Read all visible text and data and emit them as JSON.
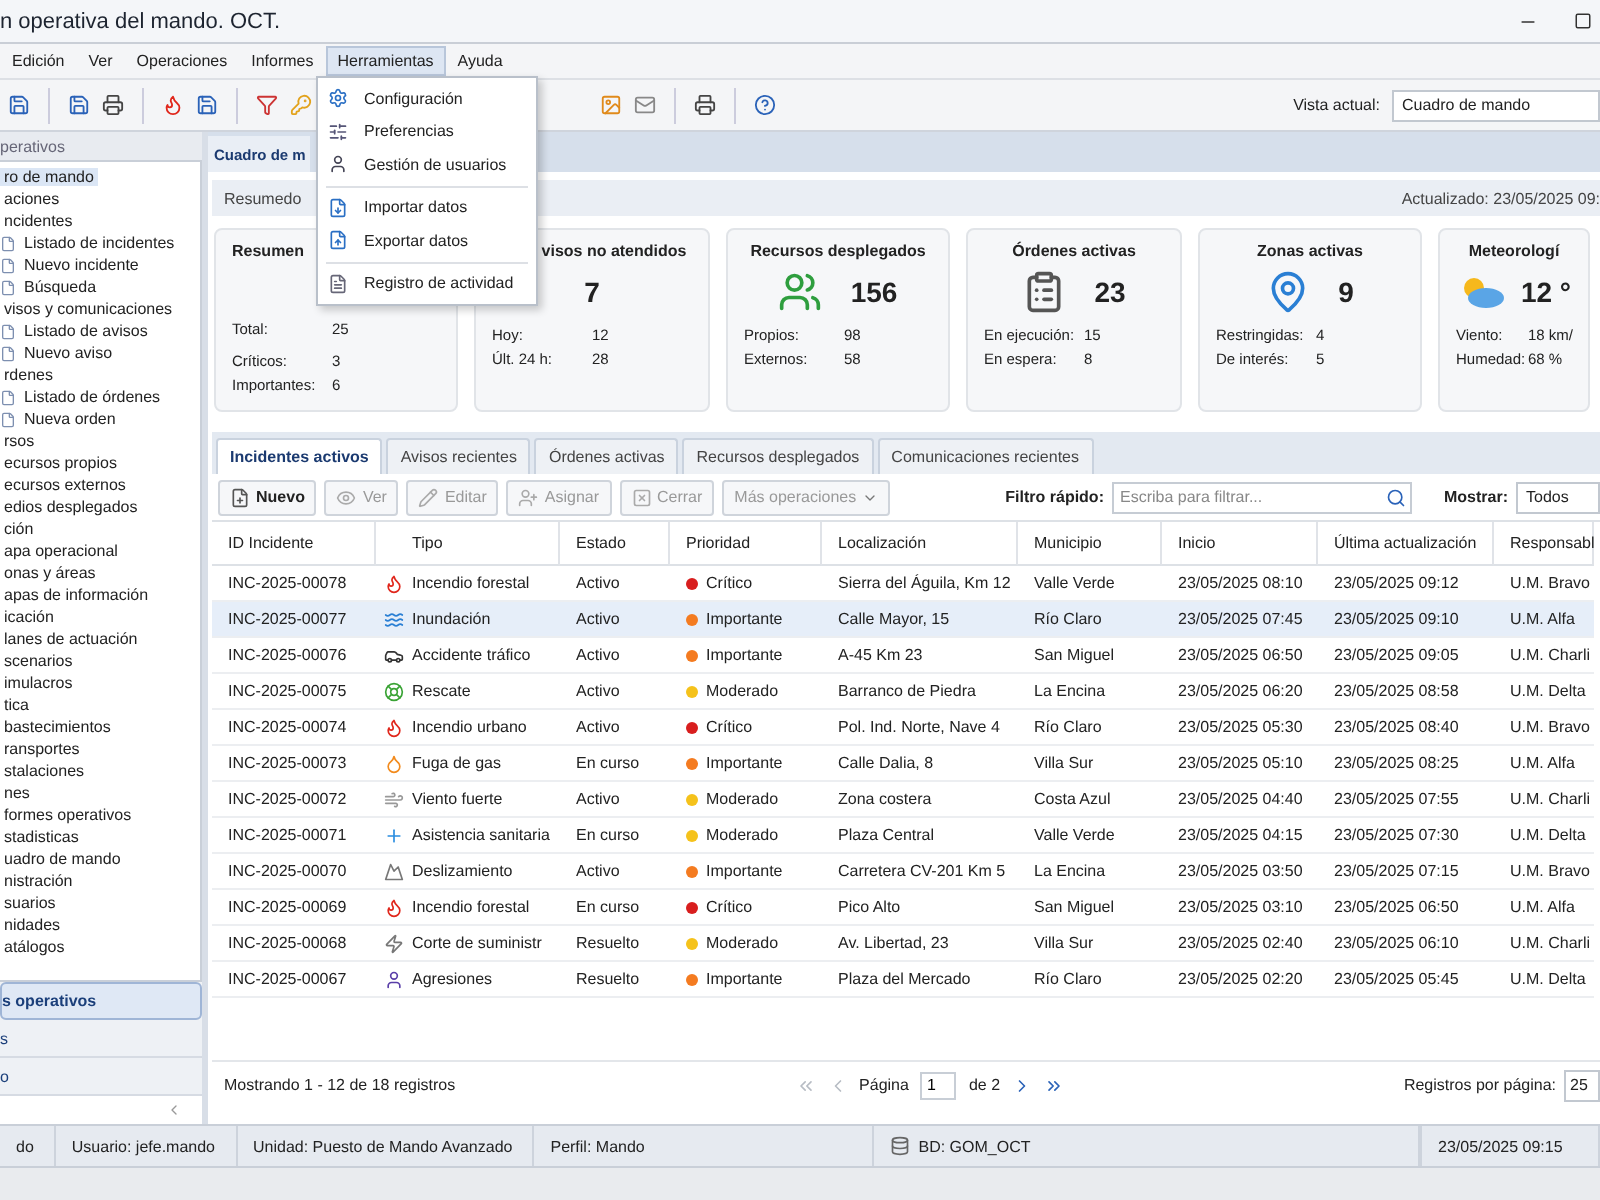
{
  "window": {
    "title": "n operativa del mando. OCT."
  },
  "menu": [
    {
      "label": "Edición",
      "selected": false
    },
    {
      "label": "Ver",
      "selected": false
    },
    {
      "label": "Operaciones",
      "selected": false
    },
    {
      "label": "Informes",
      "selected": false
    },
    {
      "label": "Herramientas",
      "selected": true
    },
    {
      "label": "Ayuda",
      "selected": false
    }
  ],
  "dropdown": [
    [
      "Configuración",
      "Preferencias",
      "Gestión de usuarios"
    ],
    [
      "Importar datos",
      "Exportar datos"
    ],
    [
      "Registro de actividad"
    ]
  ],
  "view": {
    "label": "Vista actual:",
    "value": "Cuadro de mando"
  },
  "sidebar": {
    "title": "perativos",
    "tree": [
      {
        "label": "ro de mando",
        "selected": true
      },
      {
        "label": "aciones",
        "selected": false,
        "children": [
          {
            "label": "ncidentes",
            "selected": false,
            "children": [
              {
                "label": "Listado de incidentes",
                "selected": false
              },
              {
                "label": "Nuevo incidente",
                "selected": false
              },
              {
                "label": "Búsqueda",
                "selected": false
              }
            ]
          },
          {
            "label": "visos y comunicaciones",
            "selected": false,
            "children": [
              {
                "label": "Listado de avisos",
                "selected": false
              },
              {
                "label": "Nuevo aviso",
                "selected": false
              }
            ]
          },
          {
            "label": "rdenes",
            "selected": false,
            "children": [
              {
                "label": "Listado de órdenes",
                "selected": false
              },
              {
                "label": "Nueva orden",
                "selected": false
              }
            ]
          }
        ]
      },
      {
        "label": "rsos",
        "selected": false,
        "children": [
          {
            "label": "ecursos propios",
            "selected": false
          },
          {
            "label": "ecursos externos",
            "selected": false
          },
          {
            "label": "edios desplegados",
            "selected": false
          }
        ]
      },
      {
        "label": "ción",
        "selected": false,
        "children": [
          {
            "label": "apa operacional",
            "selected": false
          },
          {
            "label": "onas y áreas",
            "selected": false
          },
          {
            "label": "apas de información",
            "selected": false
          }
        ]
      },
      {
        "label": "icación",
        "selected": false,
        "children": [
          {
            "label": "lanes de actuación",
            "selected": false
          },
          {
            "label": "scenarios",
            "selected": false
          },
          {
            "label": "imulacros",
            "selected": false
          }
        ]
      },
      {
        "label": "tica",
        "selected": false,
        "children": [
          {
            "label": "bastecimientos",
            "selected": false
          },
          {
            "label": "ransportes",
            "selected": false
          },
          {
            "label": "stalaciones",
            "selected": false
          }
        ]
      },
      {
        "label": "nes",
        "selected": false,
        "children": [
          {
            "label": "formes operativos",
            "selected": false
          },
          {
            "label": "stadisticas",
            "selected": false
          },
          {
            "label": "uadro de mando",
            "selected": false
          }
        ]
      },
      {
        "label": "nistración",
        "selected": false,
        "children": [
          {
            "label": "suarios",
            "selected": false
          },
          {
            "label": "nidades",
            "selected": false
          },
          {
            "label": "atálogos",
            "selected": false
          }
        ]
      }
    ],
    "sections": [
      {
        "label": "s operativos",
        "selected": true
      },
      {
        "label": "s",
        "selected": false
      },
      {
        "label": "o",
        "selected": false
      }
    ]
  },
  "main_tab": "Cuadro de m",
  "summary": {
    "title": "Resumedo",
    "updated": "Actualizado: 23/05/2025 09:"
  },
  "cards": [
    {
      "title": "Resumen",
      "kind": "none",
      "stats": [
        [
          "Total:",
          "25"
        ],
        [
          "Críticos:",
          "3"
        ],
        [
          "Importantes:",
          "6"
        ]
      ]
    },
    {
      "title": "visos no atendidos",
      "value": "7",
      "kind": "none",
      "stats": [
        [
          "Hoy:",
          "12"
        ],
        [
          "Últ. 24 h:",
          "28"
        ]
      ]
    },
    {
      "title": "Recursos desplegados",
      "value": "156",
      "kind": "people",
      "stats": [
        [
          "Propios:",
          "98"
        ],
        [
          "Externos:",
          "58"
        ]
      ]
    },
    {
      "title": "Órdenes activas",
      "value": "23",
      "kind": "clipboard",
      "stats": [
        [
          "En ejecución:",
          "15"
        ],
        [
          "En espera:",
          "8"
        ]
      ]
    },
    {
      "title": "Zonas activas",
      "value": "9",
      "kind": "pin",
      "stats": [
        [
          "Restringidas:",
          "4"
        ],
        [
          "De interés:",
          "5"
        ]
      ]
    },
    {
      "title": "Meteorologí",
      "value": "12 °",
      "kind": "weather",
      "stats": [
        [
          "Viento:",
          "18 km/"
        ],
        [
          "Humedad:",
          "68 %"
        ]
      ]
    }
  ],
  "tabs": [
    {
      "label": "Incidentes activos",
      "selected": true
    },
    {
      "label": "Avisos recientes",
      "selected": false
    },
    {
      "label": "Órdenes activas",
      "selected": false
    },
    {
      "label": "Recursos desplegados",
      "selected": false
    },
    {
      "label": "Comunicaciones recientes",
      "selected": false
    }
  ],
  "actions": [
    {
      "label": "Nuevo",
      "kind": "new",
      "disabled": false
    },
    {
      "label": "Ver",
      "kind": "view",
      "disabled": true
    },
    {
      "label": "Editar",
      "kind": "edit",
      "disabled": true
    },
    {
      "label": "Asignar",
      "kind": "assign",
      "disabled": true
    },
    {
      "label": "Cerrar",
      "kind": "close",
      "disabled": true
    },
    {
      "label": "Más operaciones",
      "kind": "more",
      "disabled": true
    }
  ],
  "filter": {
    "label": "Filtro rápido:",
    "placeholder": "Escriba para filtrar...",
    "show_label": "Mostrar:",
    "show_value": "Todos"
  },
  "table": {
    "columns": [
      "ID Incidente",
      "Tipo",
      "Estado",
      "Prioridad",
      "Localización",
      "Municipio",
      "Inicio",
      "Última actualización",
      "Responsabl"
    ],
    "rows": [
      {
        "id": "INC-2025-00078",
        "kind": "fire",
        "type": "Incendio forestal",
        "status": "Activo",
        "priority": "Crítico",
        "color": "#d81e1e",
        "place": "Sierra del Águila, Km 12",
        "town": "Valle Verde",
        "start": "23/05/2025 08:10",
        "update": "23/05/2025 09:12",
        "owner": "U.M. Bravo",
        "selected": false
      },
      {
        "id": "INC-2025-00077",
        "kind": "flood",
        "type": "Inundación",
        "status": "Activo",
        "priority": "Importante",
        "color": "#f47b20",
        "place": "Calle Mayor, 15",
        "town": "Río Claro",
        "start": "23/05/2025 07:45",
        "update": "23/05/2025 09:10",
        "owner": "U.M. Alfa",
        "selected": true
      },
      {
        "id": "INC-2025-00076",
        "kind": "car",
        "type": "Accidente tráfico",
        "status": "Activo",
        "priority": "Importante",
        "color": "#f47b20",
        "place": "A-45 Km 23",
        "town": "San Miguel",
        "start": "23/05/2025 06:50",
        "update": "23/05/2025 09:05",
        "owner": "U.M. Charli",
        "selected": false
      },
      {
        "id": "INC-2025-00075",
        "kind": "rescue",
        "type": "Rescate",
        "status": "Activo",
        "priority": "Moderado",
        "color": "#f5c21b",
        "place": "Barranco de Piedra",
        "town": "La Encina",
        "start": "23/05/2025 06:20",
        "update": "23/05/2025 08:58",
        "owner": "U.M. Delta",
        "selected": false
      },
      {
        "id": "INC-2025-00074",
        "kind": "fire",
        "type": "Incendio urbano",
        "status": "Activo",
        "priority": "Crítico",
        "color": "#d81e1e",
        "place": "Pol. Ind. Norte, Nave 4",
        "town": "Río Claro",
        "start": "23/05/2025 05:30",
        "update": "23/05/2025 08:40",
        "owner": "U.M. Bravo",
        "selected": false
      },
      {
        "id": "INC-2025-00073",
        "kind": "gas",
        "type": "Fuga de gas",
        "status": "En curso",
        "priority": "Importante",
        "color": "#f47b20",
        "place": "Calle Dalia, 8",
        "town": "Villa Sur",
        "start": "23/05/2025 05:10",
        "update": "23/05/2025 08:25",
        "owner": "U.M. Alfa",
        "selected": false
      },
      {
        "id": "INC-2025-00072",
        "kind": "wind",
        "type": "Viento fuerte",
        "status": "Activo",
        "priority": "Moderado",
        "color": "#f5c21b",
        "place": "Zona costera",
        "town": "Costa Azul",
        "start": "23/05/2025 04:40",
        "update": "23/05/2025 07:55",
        "owner": "U.M. Charli",
        "selected": false
      },
      {
        "id": "INC-2025-00071",
        "kind": "medical",
        "type": "Asistencia sanitaria",
        "status": "En curso",
        "priority": "Moderado",
        "color": "#f5c21b",
        "place": "Plaza Central",
        "town": "Valle Verde",
        "start": "23/05/2025 04:15",
        "update": "23/05/2025 07:30",
        "owner": "U.M. Delta",
        "selected": false
      },
      {
        "id": "INC-2025-00070",
        "kind": "landslide",
        "type": "Deslizamiento",
        "status": "Activo",
        "priority": "Importante",
        "color": "#f47b20",
        "place": "Carretera CV-201 Km 5",
        "town": "La Encina",
        "start": "23/05/2025 03:50",
        "update": "23/05/2025 07:15",
        "owner": "U.M. Bravo",
        "selected": false
      },
      {
        "id": "INC-2025-00069",
        "kind": "fire",
        "type": "Incendio forestal",
        "status": "En curso",
        "priority": "Crítico",
        "color": "#d81e1e",
        "place": "Pico Alto",
        "town": "San Miguel",
        "start": "23/05/2025 03:10",
        "update": "23/05/2025 06:50",
        "owner": "U.M. Alfa",
        "selected": false
      },
      {
        "id": "INC-2025-00068",
        "kind": "power",
        "type": "Corte de suministr",
        "status": "Resuelto",
        "priority": "Moderado",
        "color": "#f5c21b",
        "place": "Av. Libertad, 23",
        "town": "Villa Sur",
        "start": "23/05/2025 02:40",
        "update": "23/05/2025 06:10",
        "owner": "U.M. Charli",
        "selected": false
      },
      {
        "id": "INC-2025-00067",
        "kind": "assault",
        "type": "Agresiones",
        "status": "Resuelto",
        "priority": "Importante",
        "color": "#f47b20",
        "place": "Plaza del Mercado",
        "town": "Río Claro",
        "start": "23/05/2025 02:20",
        "update": "23/05/2025 05:45",
        "owner": "U.M. Delta",
        "selected": false
      }
    ]
  },
  "pager": {
    "info": "Mostrando 1 - 12 de 18 registros",
    "page_label": "Página",
    "page": "1",
    "of": "de 2",
    "nav": [
      {
        "kind": "first",
        "disabled": true
      },
      {
        "kind": "prev",
        "disabled": true
      },
      {
        "kind": "next",
        "disabled": false
      },
      {
        "kind": "last",
        "disabled": false
      }
    ],
    "per_page_label": "Registros por página:",
    "per_page": "25"
  },
  "status_bar": {
    "left": "do",
    "user": "Usuario: jefe.mando",
    "unit": "Unidad: Puesto de Mando Avanzado",
    "profile": "Perfil: Mando",
    "db": "BD: GOM_OCT",
    "time": "23/05/2025 09:15"
  }
}
